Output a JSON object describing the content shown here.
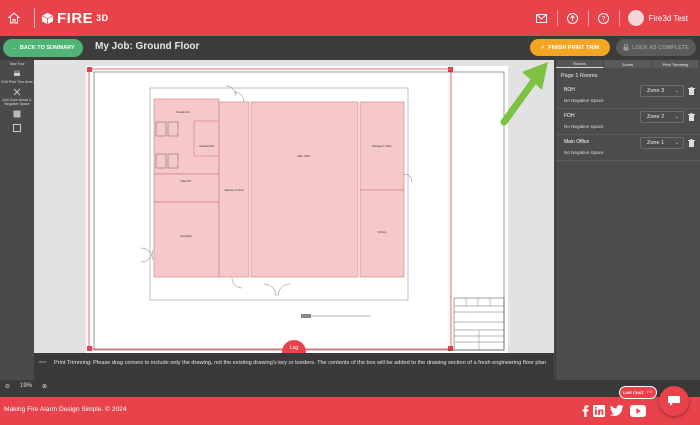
{
  "header": {
    "logo_text": "FIRE",
    "logo_sup": "3D",
    "username": "Fire3d Test"
  },
  "subbar": {
    "back_label": "BACK TO SUMMARY",
    "job_title": "My Job: Ground Floor",
    "finish_label": "FINISH PRINT TRIM",
    "lock_label": "LOCK AS COMPLETE"
  },
  "left_tools": {
    "take_tour": "Take Tour",
    "trim_label": "Edit Print Trim Area",
    "zones_label": "Add Zone Areas & Negative Space"
  },
  "drawing": {
    "rooms": [
      "Female WC",
      "Disabled WC",
      "Male WC",
      "Reception",
      "Staircase Corridor",
      "Main Office",
      "Manager's Office",
      "Kitchen"
    ],
    "log_tab": "Log"
  },
  "right_panel": {
    "tabs": [
      "Rooms",
      "Zones",
      "Print Trimming"
    ],
    "page_heading": "Page 1 Rooms",
    "rooms": [
      {
        "name": "BOH",
        "zone": "Zone 3",
        "negative": "No Negative Space"
      },
      {
        "name": "FOH",
        "zone": "Zone 2",
        "negative": "No Negative Space"
      },
      {
        "name": "Main Office",
        "zone": "Zone 1",
        "negative": "No Negative Space"
      }
    ]
  },
  "info": {
    "icon_label": "area",
    "text": "Print Trimming: Please drag corners to include only the drawing, not the existing drawing's key or borders. The contents of the box will be added to the drawing section of a fresh engineering floor plan"
  },
  "zoom": {
    "level": "19%"
  },
  "footer": {
    "copyright": "Making Fire Alarm Design Simple. © 2024",
    "live_chat": "LIVE CHAT"
  },
  "colors": {
    "brand": "#e8434a",
    "success": "#4fb476",
    "warning": "#f4a623",
    "arrow": "#7dc242",
    "room_fill": "#f6c9c9"
  }
}
